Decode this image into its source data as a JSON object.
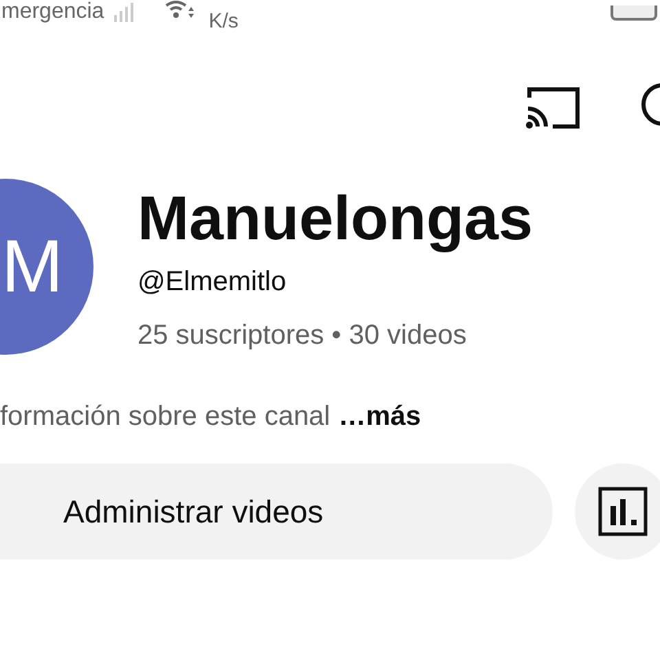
{
  "status_bar": {
    "carrier": "mergencia",
    "speed": "K/s"
  },
  "channel": {
    "avatar_letter": "M",
    "name": "Manuelongas",
    "handle": "@Elmemitlo",
    "stats": "25 suscriptores • 30 videos"
  },
  "description": {
    "text": "formación sobre este canal",
    "more_link": "…más"
  },
  "actions": [
    {
      "kind": "text",
      "label": "Administrar videos"
    },
    {
      "kind": "stats_icon"
    }
  ]
}
